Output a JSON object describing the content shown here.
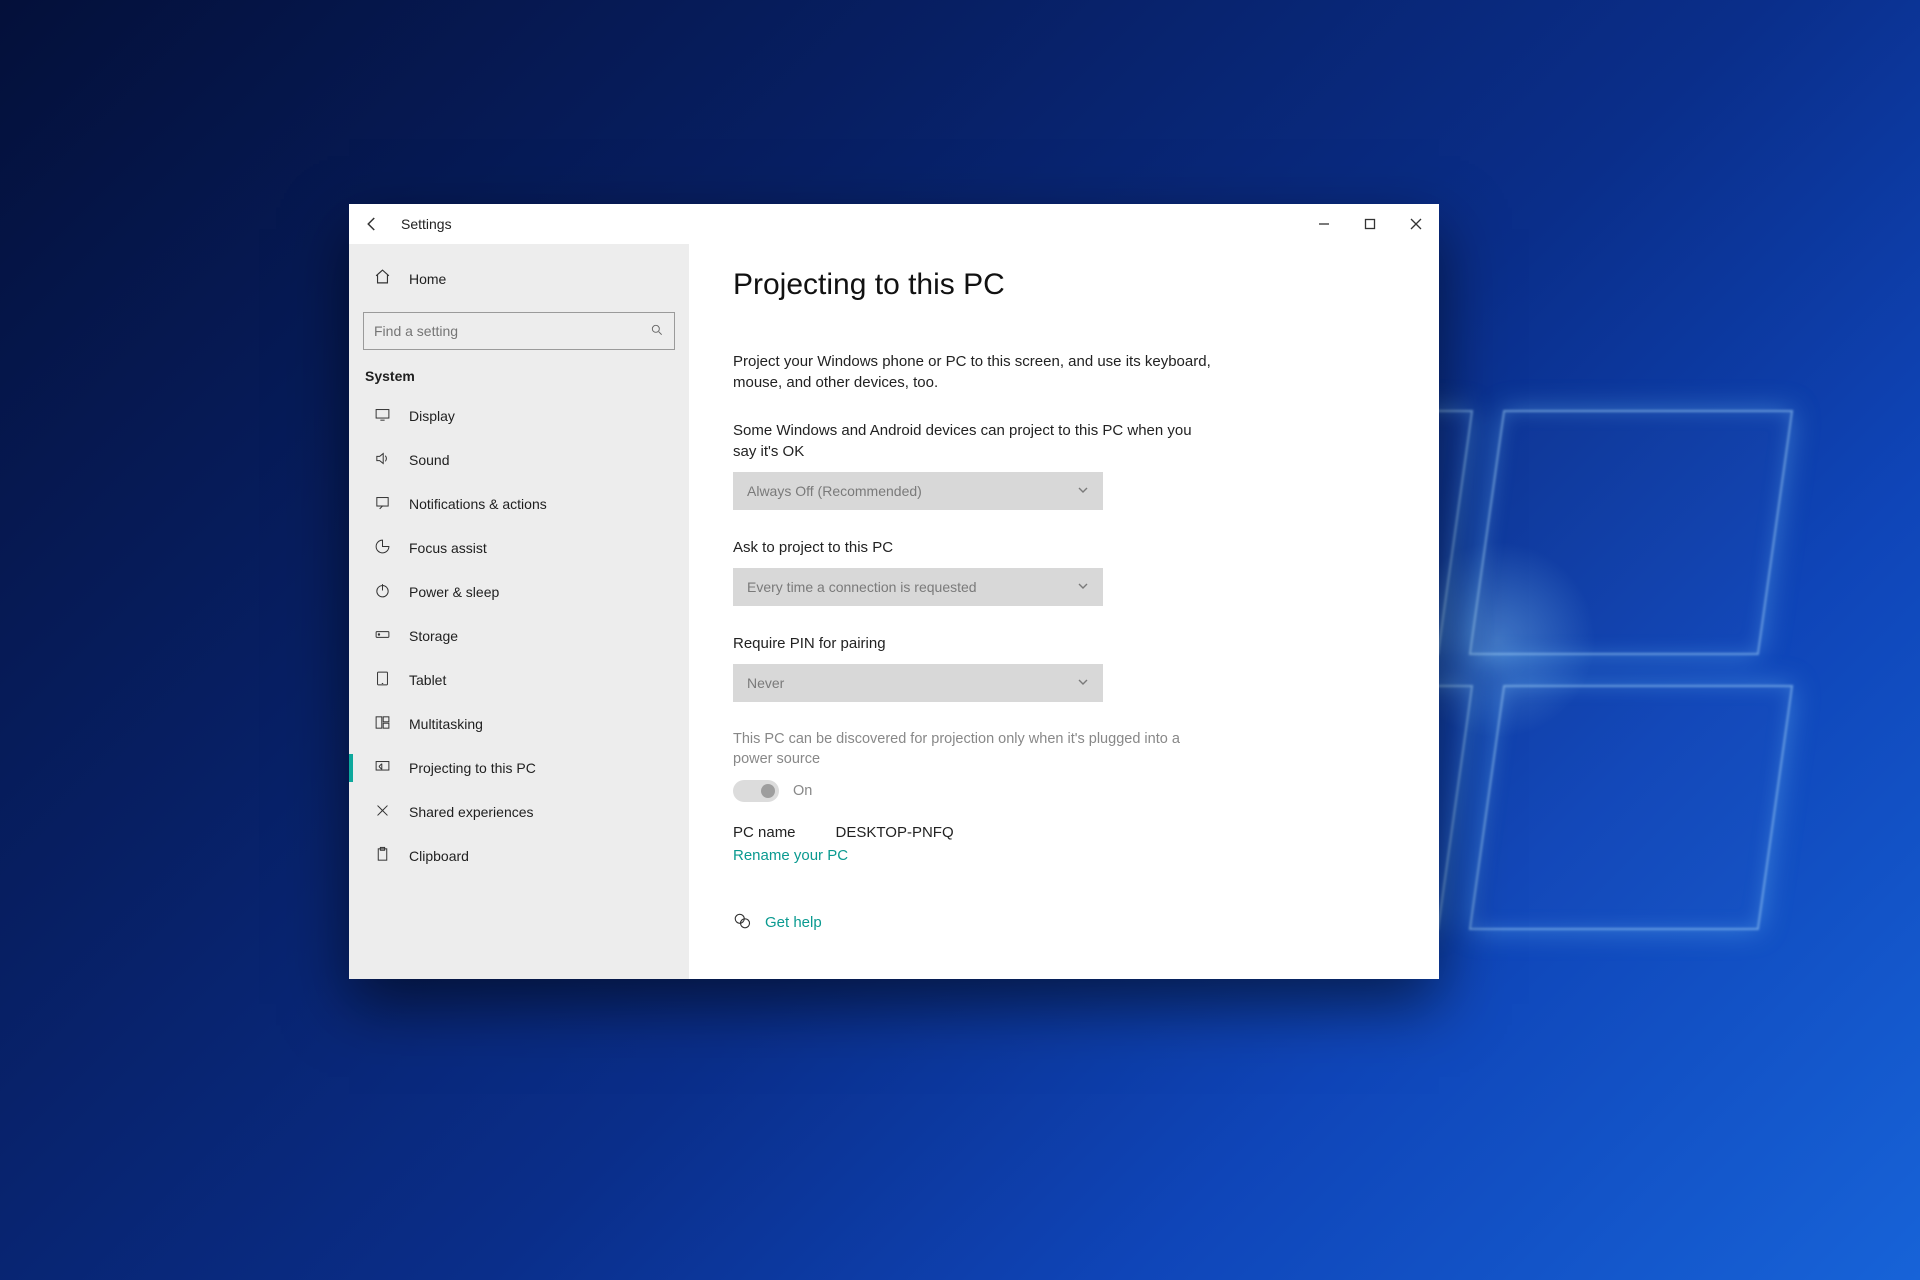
{
  "app": {
    "title": "Settings"
  },
  "sidebar": {
    "home": "Home",
    "search_placeholder": "Find a setting",
    "section": "System",
    "items": [
      {
        "label": "Display"
      },
      {
        "label": "Sound"
      },
      {
        "label": "Notifications & actions"
      },
      {
        "label": "Focus assist"
      },
      {
        "label": "Power & sleep"
      },
      {
        "label": "Storage"
      },
      {
        "label": "Tablet"
      },
      {
        "label": "Multitasking"
      },
      {
        "label": "Projecting to this PC"
      },
      {
        "label": "Shared experiences"
      },
      {
        "label": "Clipboard"
      }
    ]
  },
  "page": {
    "title": "Projecting to this PC",
    "description": "Project your Windows phone or PC to this screen, and use its keyboard, mouse, and other devices, too.",
    "setting1": {
      "label": "Some Windows and Android devices can project to this PC when you say it's OK",
      "value": "Always Off (Recommended)"
    },
    "setting2": {
      "label": "Ask to project to this PC",
      "value": "Every time a connection is requested"
    },
    "setting3": {
      "label": "Require PIN for pairing",
      "value": "Never"
    },
    "discoverable_note": "This PC can be discovered for projection only when it's plugged into a power source",
    "toggle_state": "On",
    "pcname_label": "PC name",
    "pcname_value": "DESKTOP-PNFQ",
    "rename_link": "Rename your PC",
    "help_link": "Get help"
  }
}
